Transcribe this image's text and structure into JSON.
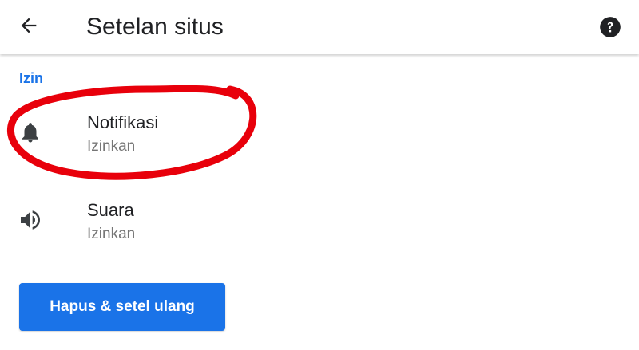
{
  "header": {
    "title": "Setelan situs",
    "back_icon": "arrow-back-icon",
    "help_icon": "help-circle-icon"
  },
  "section": {
    "title": "Izin"
  },
  "permissions": [
    {
      "title": "Notifikasi",
      "subtitle": "Izinkan",
      "icon": "bell-icon"
    },
    {
      "title": "Suara",
      "subtitle": "Izinkan",
      "icon": "volume-icon"
    }
  ],
  "actions": {
    "clear_reset_label": "Hapus & setel ulang"
  },
  "colors": {
    "accent": "#1a73e8",
    "text_primary": "#202124",
    "text_secondary": "#757575",
    "annotation": "#e8000b"
  }
}
